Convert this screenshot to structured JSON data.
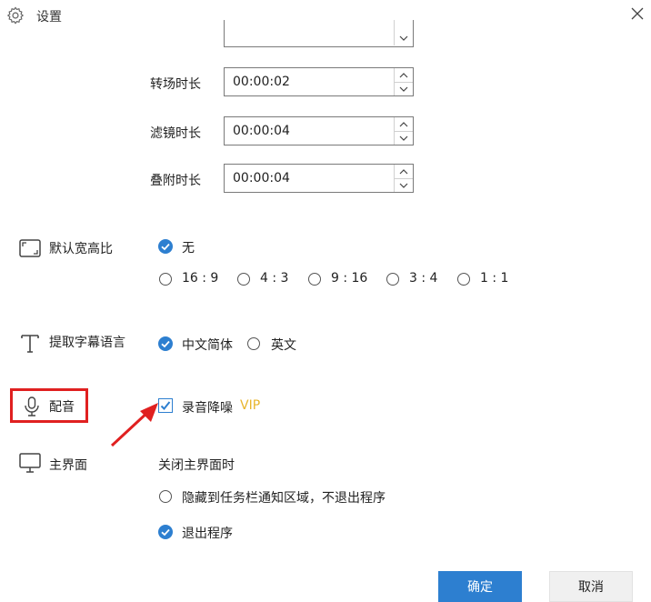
{
  "window": {
    "title": "设置",
    "close_icon": "close-icon",
    "settings_icon": "gear-icon"
  },
  "durations": [
    {
      "label": "转场时长",
      "value": "00:00:02"
    },
    {
      "label": "滤镜时长",
      "value": "00:00:04"
    },
    {
      "label": "叠附时长",
      "value": "00:00:04"
    }
  ],
  "aspect_ratio": {
    "label": "默认宽高比",
    "icon": "aspect-ratio-icon",
    "options": [
      "无",
      "16 : 9",
      "4 : 3",
      "9 : 16",
      "3 : 4",
      "1 : 1"
    ],
    "selected": "无"
  },
  "subtitle_language": {
    "label": "提取字幕语言",
    "icon": "text-icon",
    "options": [
      "中文简体",
      "英文"
    ],
    "selected": "中文简体"
  },
  "dubbing": {
    "label": "配音",
    "icon": "microphone-icon",
    "noise_reduction_label": "录音降噪",
    "noise_reduction_checked": true,
    "vip_badge": "VIP"
  },
  "main_window": {
    "label": "主界面",
    "icon": "monitor-icon",
    "on_close_label": "关闭主界面时",
    "options": [
      "隐藏到任务栏通知区域，不退出程序",
      "退出程序"
    ],
    "selected": "退出程序"
  },
  "footer": {
    "ok_label": "确定",
    "cancel_label": "取消"
  },
  "colors": {
    "accent": "#2d7fd0",
    "vip": "#e8b52c",
    "annotation_red": "#e02020"
  }
}
